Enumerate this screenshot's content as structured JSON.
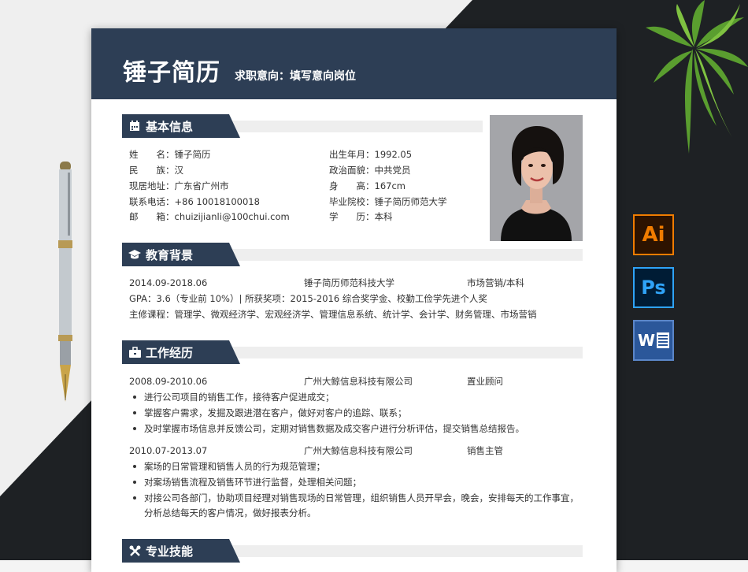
{
  "resume": {
    "name": "锤子简历",
    "intent": "求职意向：填写意向岗位",
    "basic": {
      "title": "基本信息",
      "left": [
        {
          "label": "姓　　名：",
          "value": "锤子简历"
        },
        {
          "label": "民　　族：",
          "value": "汉"
        },
        {
          "label": "现居地址：",
          "value": "广东省广州市"
        },
        {
          "label": "联系电话：",
          "value": "+86 10018100018"
        },
        {
          "label": "邮　　箱：",
          "value": "chuizijianli@100chui.com"
        }
      ],
      "right": [
        {
          "label": "出生年月：",
          "value": "1992.05"
        },
        {
          "label": "政治面貌：",
          "value": "中共党员"
        },
        {
          "label": "身　　高：",
          "value": "167cm"
        },
        {
          "label": "毕业院校：",
          "value": "锤子简历师范大学"
        },
        {
          "label": "学　　历：",
          "value": "本科"
        }
      ]
    },
    "education": {
      "title": "教育背景",
      "period": "2014.09-2018.06",
      "school": "锤子简历师范科技大学",
      "major": "市场营销/本科",
      "gpa": "GPA：3.6（专业前 10%）| 所获奖项：2015-2016 综合奖学金、校勤工俭学先进个人奖",
      "courses": "主修课程：管理学、微观经济学、宏观经济学、管理信息系统、统计学、会计学、财务管理、市场营销"
    },
    "work": {
      "title": "工作经历",
      "jobs": [
        {
          "period": "2008.09-2010.06",
          "company": "广州大鲸信息科技有限公司",
          "role": "置业顾问",
          "duties": [
            "进行公司项目的销售工作，接待客户促进成交；",
            "掌握客户需求，发掘及跟进潜在客户，做好对客户的追踪、联系；",
            "及时掌握市场信息并反馈公司，定期对销售数据及成交客户进行分析评估，提交销售总结报告。"
          ]
        },
        {
          "period": "2010.07-2013.07",
          "company": "广州大鲸信息科技有限公司",
          "role": "销售主管",
          "duties": [
            "案场的日常管理和销售人员的行为规范管理；",
            "对案场销售流程及销售环节进行监督，处理相关问题；",
            "对接公司各部门，协助项目经理对销售现场的日常管理，组织销售人员开早会，晚会，安排每天的工作事宜，"
          ],
          "duty_continuation": "分析总结每天的客户情况，做好报表分析。"
        }
      ]
    },
    "skills": {
      "title": "专业技能"
    }
  },
  "icons": {
    "ai": "Ai",
    "ps": "Ps",
    "word": "W"
  },
  "colors": {
    "header": "#2d3e55",
    "ai_accent": "#f07c00",
    "ps_accent": "#2fa3f7",
    "word_bg": "#2b579a"
  }
}
